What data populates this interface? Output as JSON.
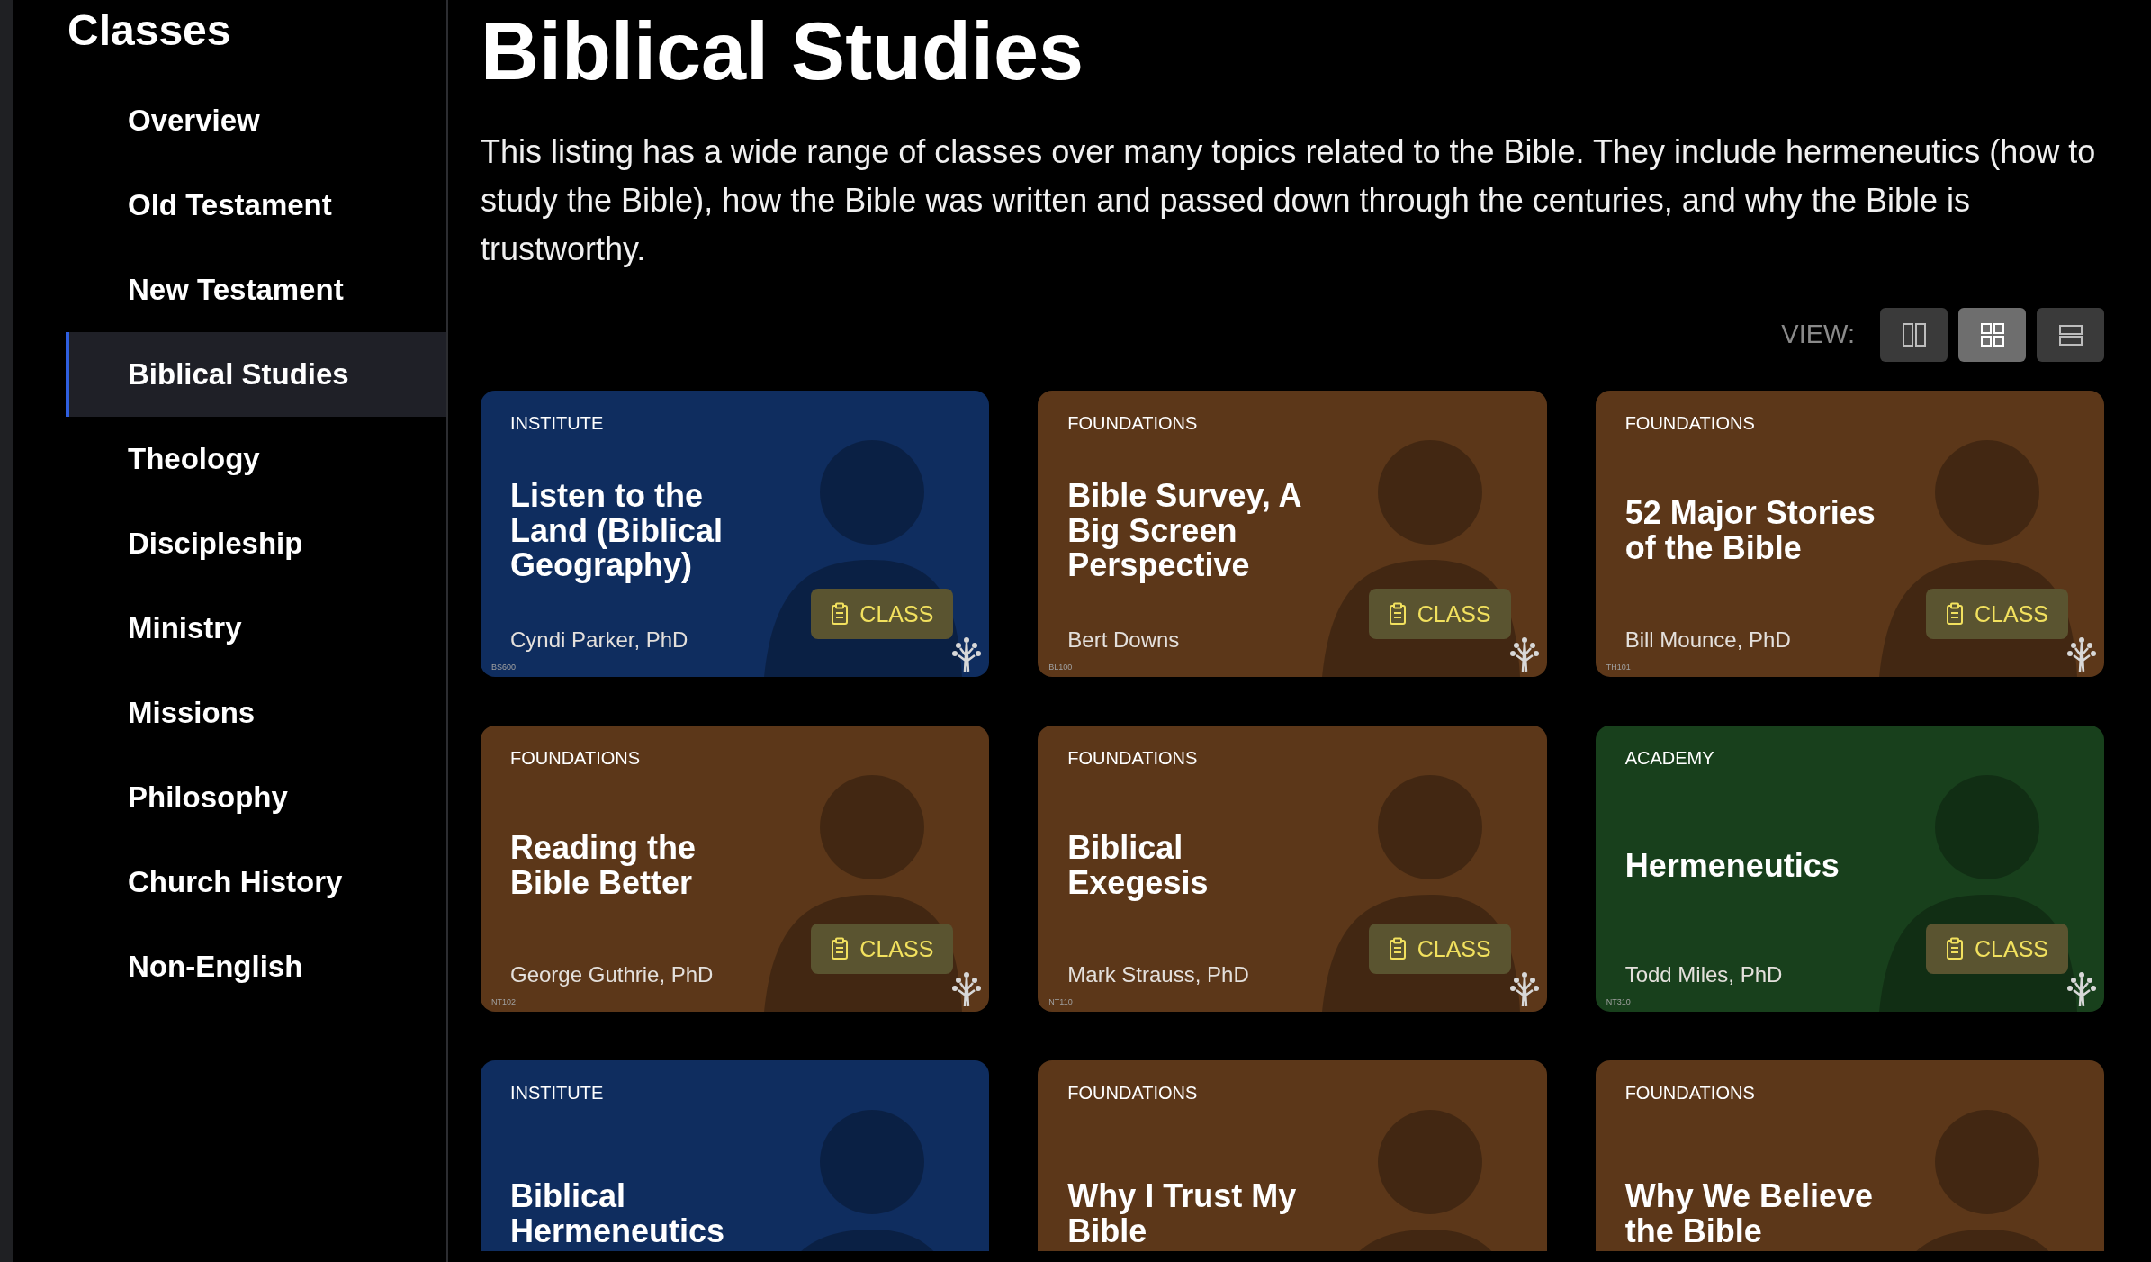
{
  "sidebar": {
    "title": "Classes",
    "items": [
      {
        "label": "Overview",
        "selected": false
      },
      {
        "label": "Old Testament",
        "selected": false
      },
      {
        "label": "New Testament",
        "selected": false
      },
      {
        "label": "Biblical Studies",
        "selected": true
      },
      {
        "label": "Theology",
        "selected": false
      },
      {
        "label": "Discipleship",
        "selected": false
      },
      {
        "label": "Ministry",
        "selected": false
      },
      {
        "label": "Missions",
        "selected": false
      },
      {
        "label": "Philosophy",
        "selected": false
      },
      {
        "label": "Church History",
        "selected": false
      },
      {
        "label": "Non-English",
        "selected": false
      }
    ]
  },
  "page": {
    "title": "Biblical Studies",
    "description": "This listing has a wide range of classes over many topics related to the Bible. They include hermeneutics (how to study the Bible), how the Bible was written and passed down through the centuries, and why the Bible is trustworthy."
  },
  "view": {
    "label": "VIEW:",
    "options": [
      {
        "kind": "columns",
        "selected": false
      },
      {
        "kind": "grid",
        "selected": true
      },
      {
        "kind": "rows",
        "selected": false
      }
    ]
  },
  "cards": [
    {
      "category": "INSTITUTE",
      "color": "#0f2d5f",
      "title": "Listen to the Land (Biblical Geography)",
      "author": "Cyndi Parker, PhD",
      "badge": "CLASS",
      "code": "BS600"
    },
    {
      "category": "FOUNDATIONS",
      "color": "#5c3719",
      "title": "Bible Survey, A Big Screen Perspective",
      "author": "Bert Downs",
      "badge": "CLASS",
      "code": "BL100"
    },
    {
      "category": "FOUNDATIONS",
      "color": "#5c3719",
      "title": "52 Major Stories of the Bible",
      "author": "Bill Mounce, PhD",
      "badge": "CLASS",
      "code": "TH101"
    },
    {
      "category": "FOUNDATIONS",
      "color": "#5c3719",
      "title": "Reading the Bible Better",
      "author": "George Guthrie, PhD",
      "badge": "CLASS",
      "code": "NT102"
    },
    {
      "category": "FOUNDATIONS",
      "color": "#5c3719",
      "title": "Biblical Exegesis",
      "author": "Mark Strauss, PhD",
      "badge": "CLASS",
      "code": "NT110"
    },
    {
      "category": "ACADEMY",
      "color": "#18401c",
      "title": "Hermeneutics",
      "author": "Todd Miles, PhD",
      "badge": "CLASS",
      "code": "NT310"
    },
    {
      "category": "INSTITUTE",
      "color": "#0f2d5f",
      "title": "Biblical Hermeneutics"
    },
    {
      "category": "FOUNDATIONS",
      "color": "#5c3719",
      "title": "Why I Trust My Bible"
    },
    {
      "category": "FOUNDATIONS",
      "color": "#5c3719",
      "title": "Why We Believe the Bible"
    }
  ]
}
